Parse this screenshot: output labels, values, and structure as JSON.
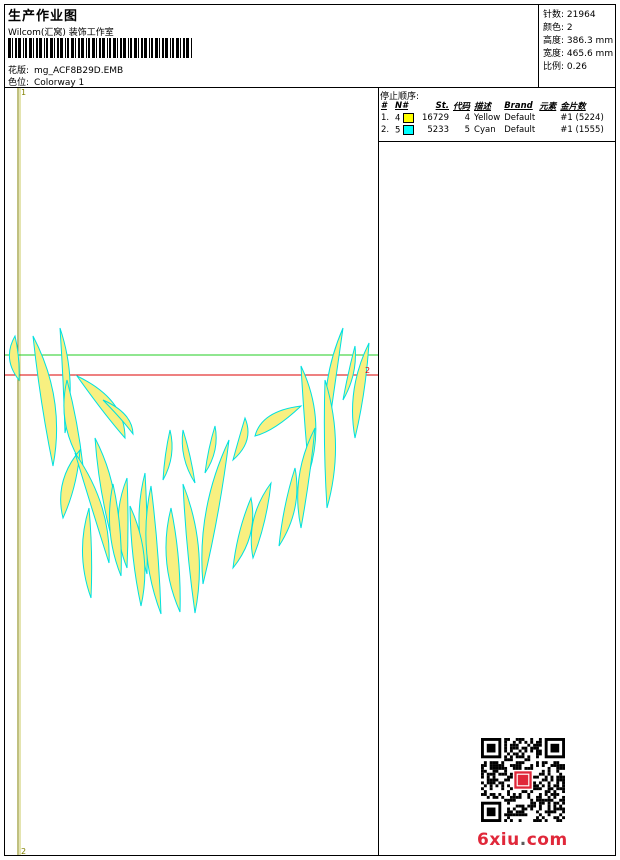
{
  "header": {
    "title": "生产作业图",
    "subtitle": "Wilcom(汇窝) 装饰工作室",
    "design_label": "花版:",
    "design_name": "mg_ACF8B29D.EMB",
    "colorway_label": "色位:",
    "colorway_name": "Colorway 1"
  },
  "stats": [
    {
      "label": "针数:",
      "value": "21964"
    },
    {
      "label": "颜色:",
      "value": "2"
    },
    {
      "label": "高度:",
      "value": "386.3 mm"
    },
    {
      "label": "宽度:",
      "value": "465.6 mm"
    },
    {
      "label": "比例:",
      "value": "0.26"
    }
  ],
  "stop_sequence": {
    "title": "停止顺序:",
    "columns": [
      "#",
      "N#",
      "St.",
      "代码",
      "描述",
      "Brand",
      "元素",
      "金片数"
    ],
    "rows": [
      {
        "idx": "1.",
        "n": "4",
        "color": "#ffff00",
        "st": "16729",
        "code": "4",
        "desc": "Yellow",
        "brand": "Default",
        "elem": "",
        "seq": "#1 (5224)"
      },
      {
        "idx": "2.",
        "n": "5",
        "color": "#00ffff",
        "st": "5233",
        "code": "5",
        "desc": "Cyan",
        "brand": "Default",
        "elem": "",
        "seq": "#1 (1555)"
      }
    ]
  },
  "markers": {
    "top": "1",
    "right": "2",
    "bottom": "2"
  },
  "watermark": {
    "pre": "6xiu",
    "dot": ".",
    "post": "com"
  },
  "colors": {
    "fill": "#f8f080",
    "outline": "#00e0e0",
    "guide_green": "#22cc22",
    "guide_red": "#dd0000",
    "guide_olive": "#808000"
  }
}
